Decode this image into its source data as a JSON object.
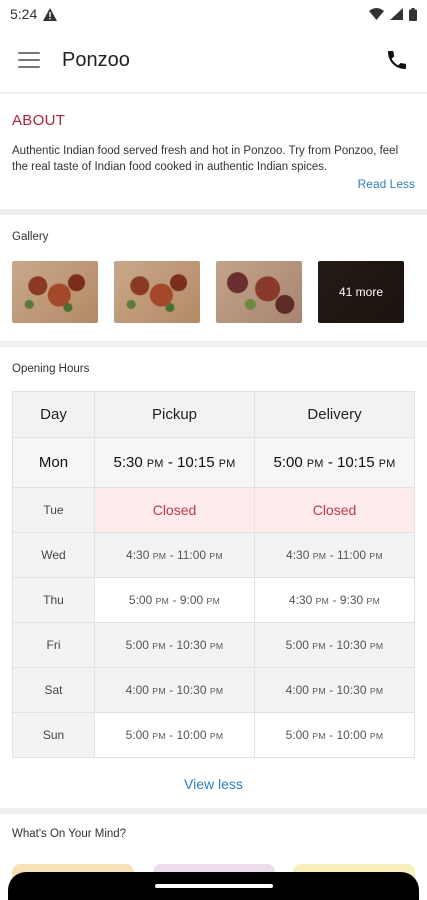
{
  "status_bar": {
    "time": "5:24",
    "alert_icon": "warning-icon",
    "icons": [
      "wifi-icon",
      "signal-icon",
      "battery-icon"
    ]
  },
  "app_bar": {
    "title": "Ponzoo",
    "menu_icon": "hamburger-menu-icon",
    "action_icon": "phone-icon"
  },
  "about": {
    "heading": "ABOUT",
    "text": "Authentic Indian food served fresh and hot in Ponzoo. Try from Ponzoo, feel the real taste of Indian food cooked in authentic Indian spices.",
    "toggle_label": "Read Less"
  },
  "gallery": {
    "label": "Gallery",
    "more_label": "41 more"
  },
  "opening_hours": {
    "label": "Opening Hours",
    "columns": [
      "Day",
      "Pickup",
      "Delivery"
    ],
    "rows": [
      {
        "day": "Mon",
        "pickup": [
          "5:30",
          "PM",
          "10:15",
          "PM"
        ],
        "delivery": [
          "5:00",
          "PM",
          "10:15",
          "PM"
        ]
      },
      {
        "day": "Tue",
        "pickup_closed": "Closed",
        "delivery_closed": "Closed"
      },
      {
        "day": "Wed",
        "pickup": [
          "4:30",
          "PM",
          "11:00",
          "PM"
        ],
        "delivery": [
          "4:30",
          "PM",
          "11:00",
          "PM"
        ]
      },
      {
        "day": "Thu",
        "pickup": [
          "5:00",
          "PM",
          "9:00",
          "PM"
        ],
        "delivery": [
          "4:30",
          "PM",
          "9:30",
          "PM"
        ]
      },
      {
        "day": "Fri",
        "pickup": [
          "5:00",
          "PM",
          "10:30",
          "PM"
        ],
        "delivery": [
          "5:00",
          "PM",
          "10:30",
          "PM"
        ]
      },
      {
        "day": "Sat",
        "pickup": [
          "4:00",
          "PM",
          "10:30",
          "PM"
        ],
        "delivery": [
          "4:00",
          "PM",
          "10:30",
          "PM"
        ]
      },
      {
        "day": "Sun",
        "pickup": [
          "5:00",
          "PM",
          "10:00",
          "PM"
        ],
        "delivery": [
          "5:00",
          "PM",
          "10:00",
          "PM"
        ]
      }
    ],
    "toggle_label": "View less"
  },
  "mind": {
    "label": "What's On Your Mind?",
    "card_colors": [
      "#f7e1b8",
      "#ecdcec",
      "#f8efbd"
    ]
  },
  "colors": {
    "accent": "#b0233a",
    "link": "#2b7fc0",
    "closed_bg": "#fdebec",
    "closed_text": "#c0394b"
  }
}
